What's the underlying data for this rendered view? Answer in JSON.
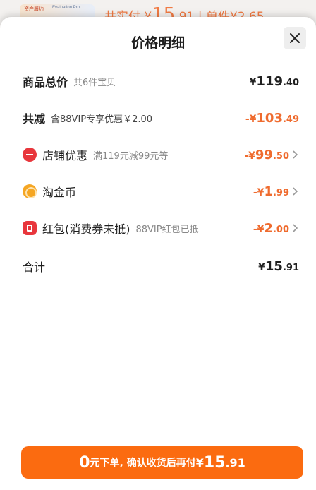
{
  "background": {
    "thumb_tag_left": "资产履约",
    "thumb_tag_right": "Evaluation Pro",
    "pay_prefix": "共实付",
    "pay_currency": "¥",
    "pay_int": "15",
    "pay_dec": ".91",
    "unit_label": "| 单件¥2.65"
  },
  "sheet": {
    "title": "价格明细",
    "close_label": "✕"
  },
  "rows": {
    "total": {
      "label": "商品总价",
      "sub": "共6件宝贝",
      "currency": "¥",
      "int": "119",
      "dec": ".40"
    },
    "reduction": {
      "label": "共减",
      "sub": "含88VIP专享优惠￥2.00",
      "currency": "-¥",
      "int": "103",
      "dec": ".49"
    },
    "store": {
      "label": "店铺优惠",
      "sub": "满119元减99元等",
      "currency": "-¥",
      "int": "99",
      "dec": ".50"
    },
    "coin": {
      "label": "淘金币",
      "currency": "-¥",
      "int": "1",
      "dec": ".99"
    },
    "redpacket": {
      "label": "红包(消费券未抵)",
      "sub": "88VIP红包已抵",
      "currency": "-¥",
      "int": "2",
      "dec": ".00"
    },
    "sum": {
      "label": "合计",
      "currency": "¥",
      "int": "15",
      "dec": ".91"
    }
  },
  "cta": {
    "zero": "0",
    "text": "元下单, 确认收货后再付",
    "currency": "¥",
    "int": "15",
    "dec": ".91"
  },
  "colors": {
    "accent_orange": "#ef6b2e",
    "cta_orange": "#fb6b10",
    "store_icon": "#e8363c",
    "coin_icon": "#f5a623"
  },
  "icons": {
    "close": "close-icon",
    "store": "store-discount-icon",
    "coin": "taojinbi-coin-icon",
    "redpacket": "red-packet-icon",
    "chevron": "chevron-right-icon"
  }
}
